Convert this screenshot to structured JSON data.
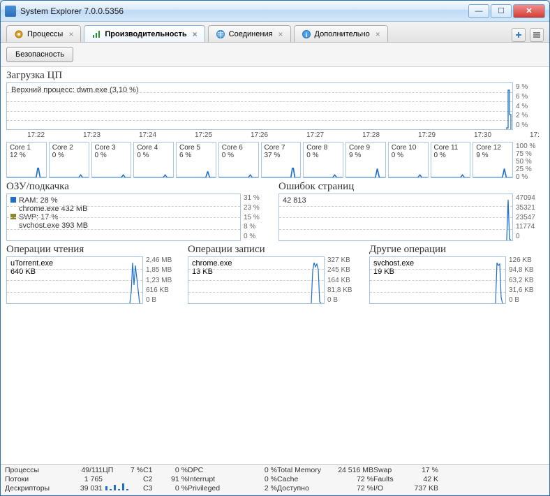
{
  "window": {
    "title": "System Explorer 7.0.0.5356"
  },
  "tabs": [
    {
      "label": "Процессы",
      "icon": "gear-icon"
    },
    {
      "label": "Производительность",
      "icon": "chart-icon",
      "active": true
    },
    {
      "label": "Соединения",
      "icon": "globe-icon"
    },
    {
      "label": "Дополнительно",
      "icon": "info-icon"
    }
  ],
  "toolbar": {
    "security_label": "Безопасность"
  },
  "cpu": {
    "title": "Загрузка ЦП",
    "top_process_label": "Верхний процесс: dwm.exe (3,10 %)",
    "y_ticks": [
      "9 %",
      "6 %",
      "4 %",
      "2 %",
      "0 %"
    ],
    "x_ticks": [
      "17:22",
      "17:23",
      "17:24",
      "17:25",
      "17:26",
      "17:27",
      "17:28",
      "17:29",
      "17:30",
      "17:"
    ]
  },
  "cores": {
    "y_ticks": [
      "100 %",
      "75 %",
      "50 %",
      "25 %",
      "0 %"
    ],
    "items": [
      {
        "name": "Core 1",
        "pct": "12 %"
      },
      {
        "name": "Core 2",
        "pct": "0 %"
      },
      {
        "name": "Core 3",
        "pct": "0 %"
      },
      {
        "name": "Core 4",
        "pct": "0 %"
      },
      {
        "name": "Core 5",
        "pct": "6 %"
      },
      {
        "name": "Core 6",
        "pct": "0 %"
      },
      {
        "name": "Core 7",
        "pct": "37 %"
      },
      {
        "name": "Core 8",
        "pct": "0 %"
      },
      {
        "name": "Core 9",
        "pct": "9 %"
      },
      {
        "name": "Core 10",
        "pct": "0 %"
      },
      {
        "name": "Core 11",
        "pct": "0 %"
      },
      {
        "name": "Core 12",
        "pct": "9 %"
      }
    ]
  },
  "ram_swap": {
    "title": "ОЗУ/подкачка",
    "ram_line": "RAM: 28 %",
    "ram_proc": "chrome.exe 432 MB",
    "swp_line": "SWP: 17 %",
    "swp_proc": "svchost.exe 393 MB",
    "y_ticks": [
      "31 %",
      "23 %",
      "15 %",
      "8 %",
      "0 %"
    ]
  },
  "page_faults": {
    "title": "Ошибок страниц",
    "value": "42 813",
    "y_ticks": [
      "47094",
      "35321",
      "23547",
      "11774",
      "0"
    ]
  },
  "ops_read": {
    "title": "Операции чтения",
    "proc": "uTorrent.exe",
    "val": "640 KB",
    "y_ticks": [
      "2,46 MB",
      "1,85 MB",
      "1,23 MB",
      "616 KB",
      "0 B"
    ]
  },
  "ops_write": {
    "title": "Операции записи",
    "proc": "chrome.exe",
    "val": "13 KB",
    "y_ticks": [
      "327 KB",
      "245 KB",
      "164 KB",
      "81,8 KB",
      "0 B"
    ]
  },
  "ops_other": {
    "title": "Другие операции",
    "proc": "svchost.exe",
    "val": "19 KB",
    "y_ticks": [
      "126 KB",
      "94,8 KB",
      "63,2 KB",
      "31,6 KB",
      "0 B"
    ]
  },
  "status": {
    "labels": {
      "processes": "Процессы",
      "threads": "Потоки",
      "handles": "Дескрипторы",
      "cpu": "ЦП",
      "dpc": "DPC",
      "interrupt": "Interrupt",
      "privileged": "Privileged",
      "total_mem": "Total Memory",
      "cache": "Cache",
      "avail": "Доступно",
      "swap": "Swap",
      "faults": "Faults",
      "io": "I/O",
      "c1": "C1",
      "c2": "C2",
      "c3": "C3"
    },
    "values": {
      "processes": "49/111",
      "threads": "1 765",
      "handles": "39 031",
      "cpu": "7 %",
      "c1": "0 %",
      "c2": "91 %",
      "c3": "0 %",
      "dpc": "0 %",
      "interrupt": "0 %",
      "privileged": "2 %",
      "total_mem": "24 516 MB",
      "cache": "72 %",
      "avail": "72 %",
      "swap": "17 %",
      "faults": "42 K",
      "io": "737 KB"
    }
  },
  "chart_data": [
    {
      "type": "line",
      "title": "Загрузка ЦП",
      "xlabel": "",
      "ylabel": "%",
      "ylim": [
        0,
        9
      ],
      "x_ticks": [
        "17:22",
        "17:23",
        "17:24",
        "17:25",
        "17:26",
        "17:27",
        "17:28",
        "17:29",
        "17:30",
        "17:"
      ],
      "series": [
        {
          "name": "CPU",
          "values": [
            0,
            0,
            0,
            0,
            0,
            0,
            0,
            0,
            0,
            9
          ]
        }
      ],
      "annotation": "Верхний процесс: dwm.exe (3,10 %)"
    },
    {
      "type": "bar",
      "title": "Cores",
      "categories": [
        "Core 1",
        "Core 2",
        "Core 3",
        "Core 4",
        "Core 5",
        "Core 6",
        "Core 7",
        "Core 8",
        "Core 9",
        "Core 10",
        "Core 11",
        "Core 12"
      ],
      "values": [
        12,
        0,
        0,
        0,
        6,
        0,
        37,
        0,
        9,
        0,
        0,
        9
      ],
      "ylabel": "%",
      "ylim": [
        0,
        100
      ]
    },
    {
      "type": "line",
      "title": "ОЗУ/подкачка",
      "ylim": [
        0,
        31
      ],
      "ylabel": "%",
      "series": [
        {
          "name": "RAM",
          "values": [
            28
          ],
          "proc": "chrome.exe 432 MB"
        },
        {
          "name": "SWP",
          "values": [
            17
          ],
          "proc": "svchost.exe 393 MB"
        }
      ]
    },
    {
      "type": "line",
      "title": "Ошибок страниц",
      "ylim": [
        0,
        47094
      ],
      "series": [
        {
          "name": "faults",
          "values": [
            42813
          ]
        }
      ]
    },
    {
      "type": "line",
      "title": "Операции чтения",
      "ylim": [
        0,
        2580000
      ],
      "series": [
        {
          "name": "uTorrent.exe",
          "values": [
            655360
          ]
        }
      ],
      "y_ticks": [
        "2,46 MB",
        "1,85 MB",
        "1,23 MB",
        "616 KB",
        "0 B"
      ]
    },
    {
      "type": "line",
      "title": "Операции записи",
      "ylim": [
        0,
        334848
      ],
      "series": [
        {
          "name": "chrome.exe",
          "values": [
            13312
          ]
        }
      ],
      "y_ticks": [
        "327 KB",
        "245 KB",
        "164 KB",
        "81,8 KB",
        "0 B"
      ]
    },
    {
      "type": "line",
      "title": "Другие операции",
      "ylim": [
        0,
        129024
      ],
      "series": [
        {
          "name": "svchost.exe",
          "values": [
            19456
          ]
        }
      ],
      "y_ticks": [
        "126 KB",
        "94,8 KB",
        "63,2 KB",
        "31,6 KB",
        "0 B"
      ]
    }
  ]
}
